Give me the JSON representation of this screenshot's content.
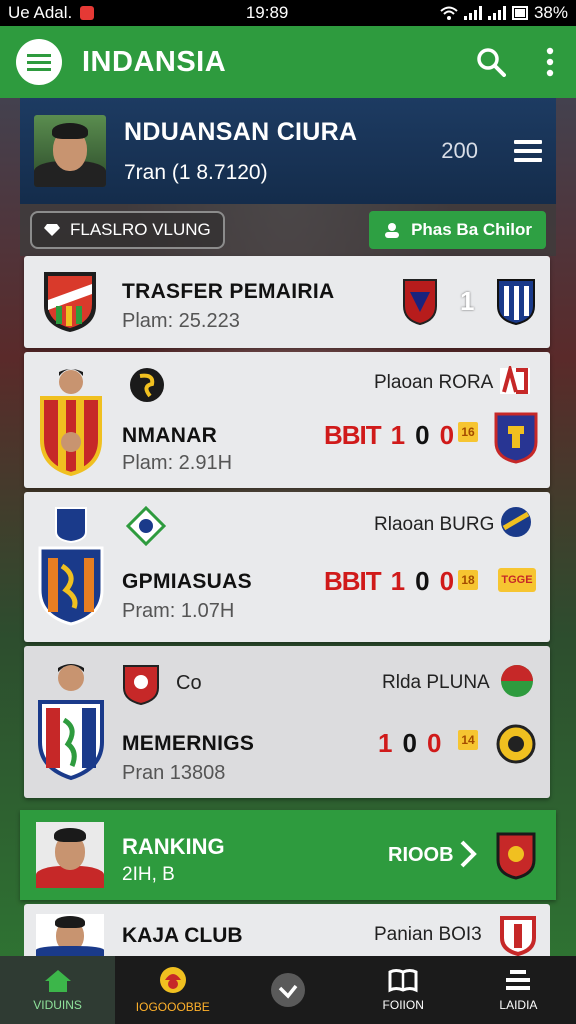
{
  "status_bar": {
    "left_text": "Ue Adal.",
    "time": "19:89",
    "battery": "38%"
  },
  "app_bar": {
    "title": "INDANSIA",
    "menu_icon": "menu-icon",
    "search_icon": "search-icon",
    "more_icon": "more-vert-icon"
  },
  "profile": {
    "name": "NDUANSAN CIURA",
    "subtitle": "7ran (1 8.7120)",
    "count": "200"
  },
  "filters": {
    "chip_label": "FLASLRO VLUNG",
    "button_label": "Phas Ba Chilor"
  },
  "cards": [
    {
      "title": "TRASFER PEMAIRIA",
      "subtitle": "Plam: 25.223",
      "score_value": "1"
    },
    {
      "title": "NMANAR",
      "subtitle": "Plam: 2.91H",
      "right_label": "Plaoan RORA",
      "score_lead": "BBIT",
      "score_a": "1",
      "score_b": "0",
      "score_c": "0",
      "tag": "16"
    },
    {
      "title": "GPMIASUAS",
      "subtitle": "Pram: 1.07H",
      "right_label": "Rlaoan BURG",
      "score_lead": "BBIT",
      "score_a": "1",
      "score_b": "0",
      "score_c": "0",
      "tag": "18",
      "extra_badge": "TGGE"
    },
    {
      "title": "MEMERNIGS",
      "subtitle": "Pran 13808",
      "right_label": "Rlda PLUNA",
      "small_text": "Co",
      "score_a": "1",
      "score_b": "0",
      "score_c": "0",
      "tag": "14"
    }
  ],
  "ranking": {
    "title": "RANKING",
    "subtitle": "2IH,  B",
    "right_text": "RIOOB"
  },
  "last_card": {
    "title": "KAJA CLUB",
    "right_label": "Panian BOI3"
  },
  "bottom_nav": [
    {
      "label": "VIDUINS",
      "icon": "home-icon"
    },
    {
      "label": "IOGOOOBBE",
      "icon": "trophy-icon"
    },
    {
      "label": "",
      "icon": "check-circle-icon"
    },
    {
      "label": "FOIION",
      "icon": "book-icon"
    },
    {
      "label": "LAIDIA",
      "icon": "list-icon"
    }
  ],
  "colors": {
    "brand_green": "#2e9b3e",
    "header_navy": "#1d3b62",
    "score_red": "#d01a1a",
    "tag_yellow": "#f6c531"
  }
}
